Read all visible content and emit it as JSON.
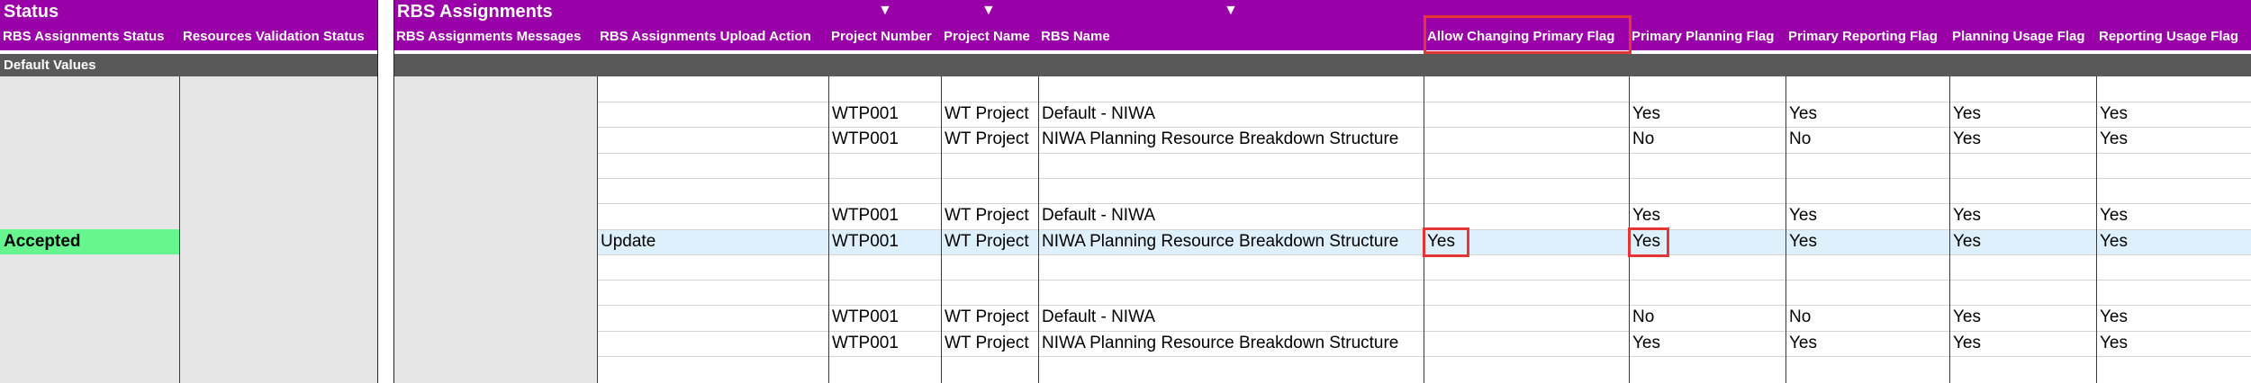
{
  "group_headers": {
    "status": "Status",
    "rbs": "RBS Assignments"
  },
  "columns": {
    "rbs_assignments_status": "RBS Assignments Status",
    "resources_validation_status": "Resources Validation Status",
    "rbs_assignments_messages": "RBS Assignments Messages",
    "upload_action": "RBS Assignments Upload Action",
    "project_number": "Project Number",
    "project_name": "Project Name",
    "rbs_name": "RBS Name",
    "allow_changing_primary": "Allow Changing Primary Flag",
    "primary_planning": "Primary Planning Flag",
    "primary_reporting": "Primary Reporting Flag",
    "planning_usage": "Planning Usage Flag",
    "reporting_usage": "Reporting Usage Flag"
  },
  "default_values_label": "Default Values",
  "filter_icon": "▼",
  "rows": [
    {
      "status": "",
      "action": "",
      "project_number": "WTP001",
      "project_name": "WT Project",
      "rbs_name": "Default - NIWA",
      "allow": "",
      "pplan": "Yes",
      "prep": "Yes",
      "plan_use": "Yes",
      "rep_use": "Yes"
    },
    {
      "status": "",
      "action": "",
      "project_number": "WTP001",
      "project_name": "WT Project",
      "rbs_name": "NIWA Planning Resource Breakdown Structure",
      "allow": "",
      "pplan": "No",
      "prep": "No",
      "plan_use": "Yes",
      "rep_use": "Yes"
    },
    {
      "status": "",
      "action": "",
      "project_number": "WTP001",
      "project_name": "WT Project",
      "rbs_name": "Default - NIWA",
      "allow": "",
      "pplan": "Yes",
      "prep": "Yes",
      "plan_use": "Yes",
      "rep_use": "Yes"
    },
    {
      "status": "Accepted",
      "action": "Update",
      "project_number": "WTP001",
      "project_name": "WT Project",
      "rbs_name": "NIWA Planning Resource Breakdown Structure",
      "allow": "Yes",
      "pplan": "Yes",
      "prep": "Yes",
      "plan_use": "Yes",
      "rep_use": "Yes"
    },
    {
      "status": "",
      "action": "",
      "project_number": "WTP001",
      "project_name": "WT Project",
      "rbs_name": "Default - NIWA",
      "allow": "",
      "pplan": "No",
      "prep": "No",
      "plan_use": "Yes",
      "rep_use": "Yes"
    },
    {
      "status": "",
      "action": "",
      "project_number": "WTP001",
      "project_name": "WT Project",
      "rbs_name": "NIWA Planning Resource Breakdown Structure",
      "allow": "",
      "pplan": "Yes",
      "prep": "Yes",
      "plan_use": "Yes",
      "rep_use": "Yes"
    }
  ]
}
